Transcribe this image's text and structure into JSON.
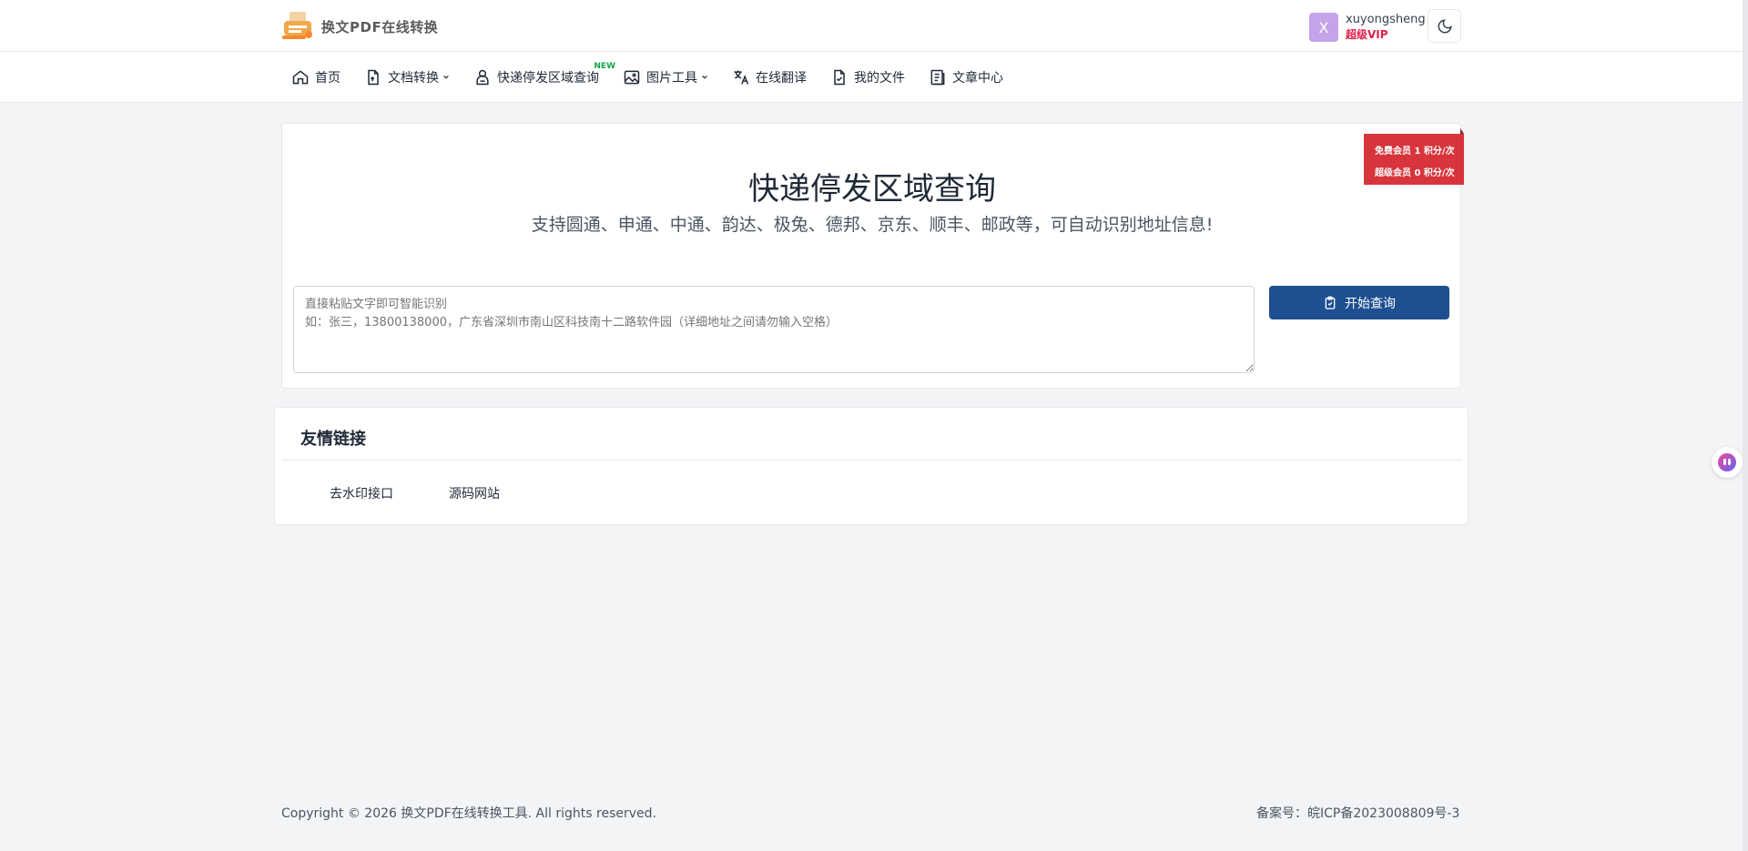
{
  "header": {
    "brand_name": "换文PDF在线转换",
    "user": {
      "avatar_letter": "X",
      "username": "xuyongsheng",
      "level": "超级VIP"
    }
  },
  "nav": {
    "items": [
      {
        "label": "首页",
        "icon": "home-icon"
      },
      {
        "label": "文档转换",
        "icon": "document-convert-icon",
        "dropdown": true
      },
      {
        "label": "快递停发区域查询",
        "icon": "user-search-icon",
        "badge": "NEW"
      },
      {
        "label": "图片工具",
        "icon": "image-icon",
        "dropdown": true
      },
      {
        "label": "在线翻译",
        "icon": "translate-icon"
      },
      {
        "label": "我的文件",
        "icon": "file-check-icon"
      },
      {
        "label": "文章中心",
        "icon": "article-icon"
      }
    ]
  },
  "main": {
    "title": "快递停发区域查询",
    "subtitle": "支持圆通、申通、中通、韵达、极兔、德邦、京东、顺丰、邮政等，可自动识别地址信息!",
    "price_free": "免费会员 1 积分/次",
    "price_vip": "超级会员 0 积分/次",
    "textarea_placeholder": "直接粘贴文字即可智能识别\n如：张三，13800138000，广东省深圳市南山区科技南十二路软件园（详细地址之间请勿输入空格）",
    "query_button": "开始查询"
  },
  "links": {
    "title": "友情链接",
    "items": [
      "去水印接口",
      "源码网站"
    ]
  },
  "footer": {
    "copyright": "Copyright © 2026 换文PDF在线转换工具. All rights reserved.",
    "icp": "备案号：皖ICP备2023008809号-3"
  },
  "colors": {
    "primary": "#1d4f91",
    "price_tag": "#d7353b",
    "vip": "#e11d48",
    "new_badge": "#16a34a"
  }
}
